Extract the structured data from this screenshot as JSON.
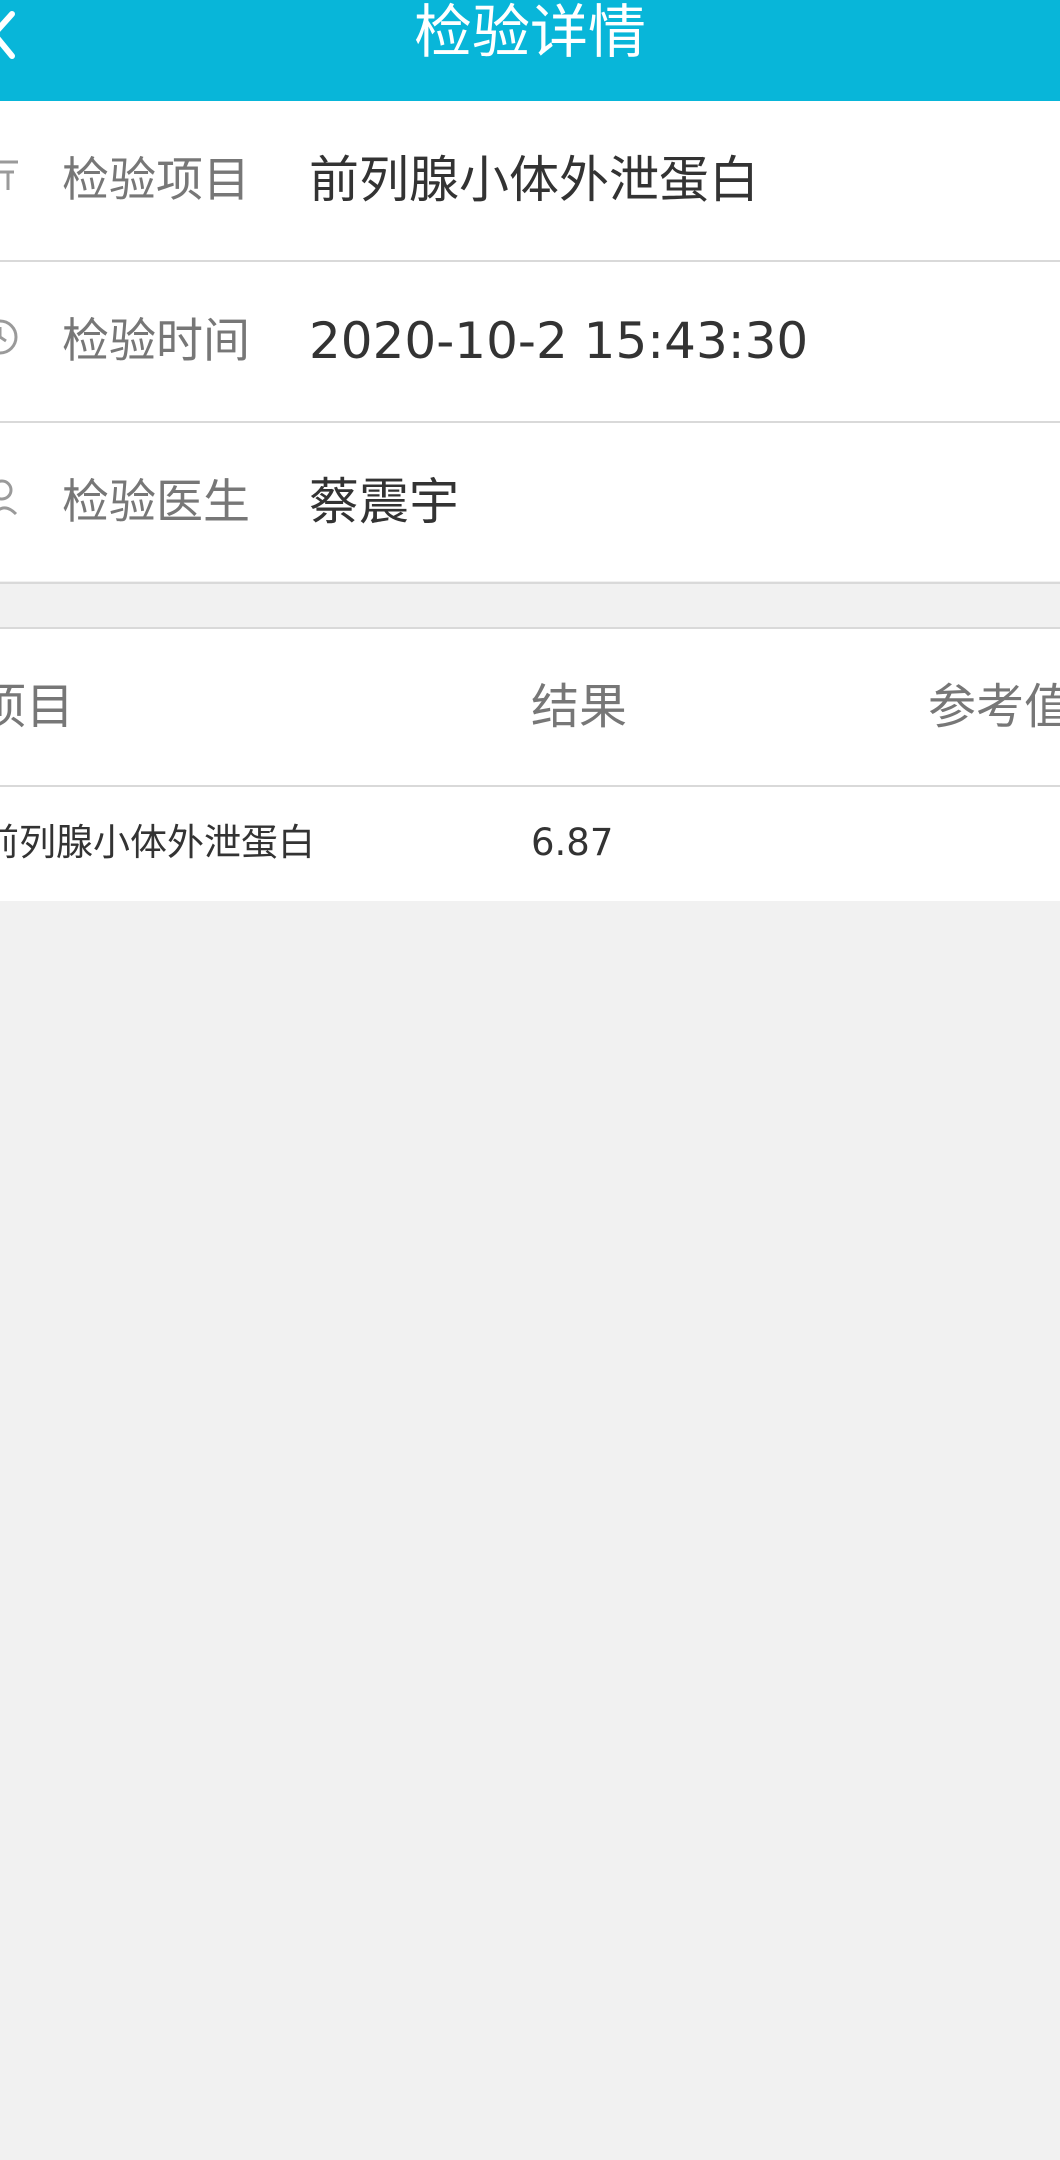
{
  "header": {
    "title": "检验详情",
    "bg_color": "#08b6d9"
  },
  "info": {
    "items": [
      {
        "icon": "list-icon",
        "label": "检验项目",
        "value": "前列腺小体外泄蛋白"
      },
      {
        "icon": "clock-icon",
        "label": "检验时间",
        "value": "2020-10-2 15:43:30"
      },
      {
        "icon": "person-icon",
        "label": "检验医生",
        "value": "蔡震宇"
      }
    ]
  },
  "results_table": {
    "columns": [
      "项目",
      "结果",
      "参考值"
    ],
    "rows": [
      {
        "item": "前列腺小体外泄蛋白",
        "result": "6.87",
        "reference": ""
      }
    ]
  }
}
